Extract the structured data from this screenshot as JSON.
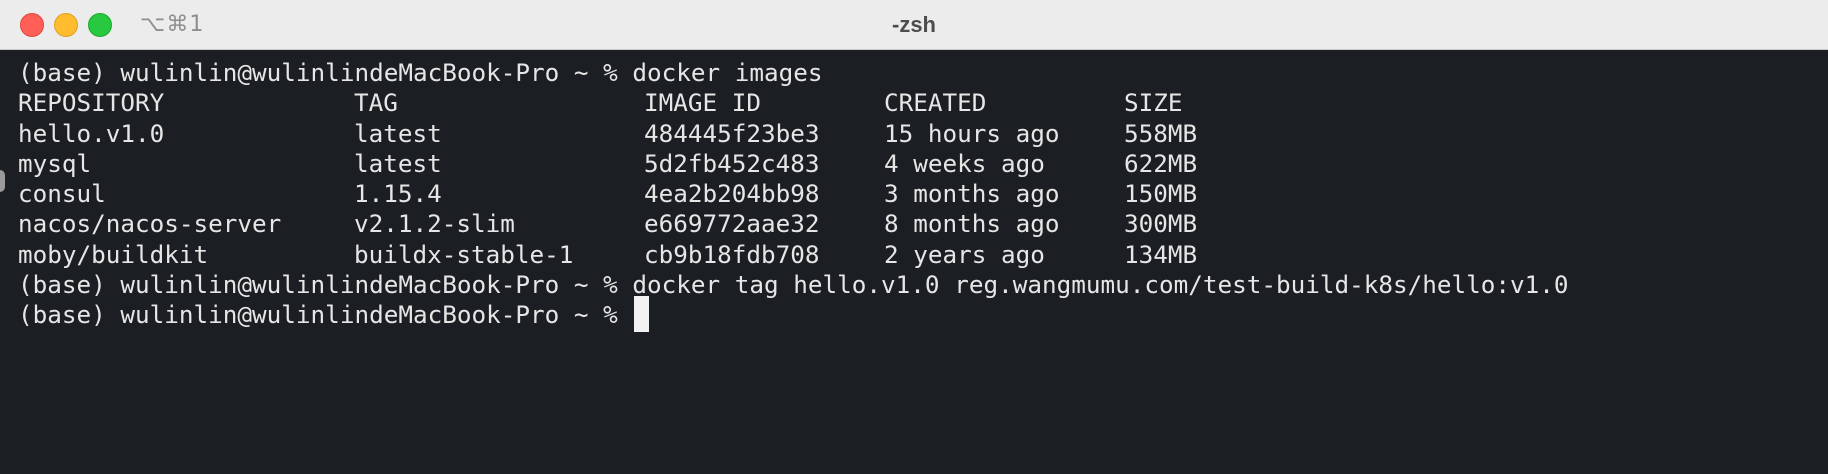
{
  "window": {
    "title": "-zsh",
    "shortcut": "⌥⌘1",
    "colors": {
      "background": "#1b1e22",
      "text": "#e6e6e6",
      "titlebar": "#ececec",
      "close": "#ff5f57",
      "minimize": "#febc2e",
      "zoom": "#28c840"
    }
  },
  "terminal": {
    "prompt": "(base) wulinlin@wulinlindeMacBook-Pro ~ % ",
    "commands": [
      "docker images",
      "docker tag hello.v1.0 reg.wangmumu.com/test-build-k8s/hello:v1.0",
      ""
    ],
    "table": {
      "headers": [
        "REPOSITORY",
        "TAG",
        "IMAGE ID",
        "CREATED",
        "SIZE"
      ],
      "rows": [
        [
          "hello.v1.0",
          "latest",
          "484445f23be3",
          "15 hours ago",
          "558MB"
        ],
        [
          "mysql",
          "latest",
          "5d2fb452c483",
          "4 weeks ago",
          "622MB"
        ],
        [
          "consul",
          "1.15.4",
          "4ea2b204bb98",
          "3 months ago",
          "150MB"
        ],
        [
          "nacos/nacos-server",
          "v2.1.2-slim",
          "e669772aae32",
          "8 months ago",
          "300MB"
        ],
        [
          "moby/buildkit",
          "buildx-stable-1",
          "cb9b18fdb708",
          "2 years ago",
          "134MB"
        ]
      ]
    }
  }
}
